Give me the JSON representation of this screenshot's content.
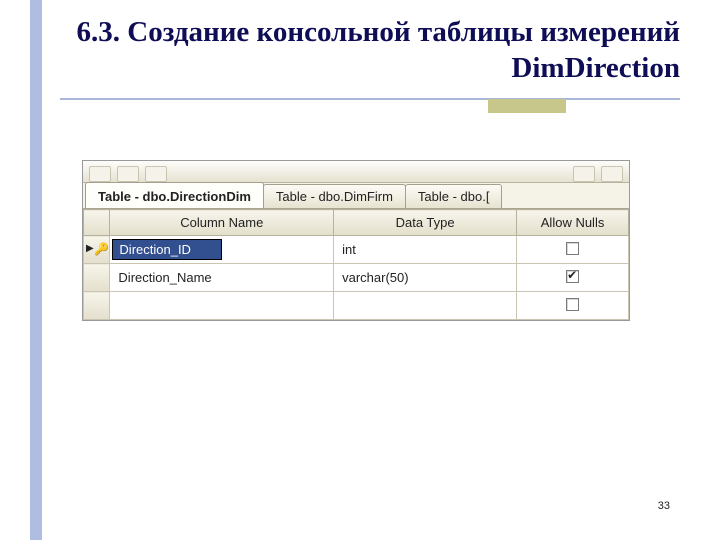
{
  "slide": {
    "title": "6.3. Создание консольной таблицы измерений DimDirection",
    "page_number": "33"
  },
  "designer": {
    "tabs": [
      {
        "label": "Table - dbo.DirectionDim",
        "active": true
      },
      {
        "label": "Table - dbo.DimFirm",
        "active": false
      },
      {
        "label": "Table - dbo.[",
        "active": false
      }
    ],
    "headers": {
      "column_name": "Column Name",
      "data_type": "Data Type",
      "allow_nulls": "Allow Nulls"
    },
    "rows": [
      {
        "name": "Direction_ID",
        "type": "int",
        "allow_nulls": false,
        "pk": true,
        "selected": true
      },
      {
        "name": "Direction_Name",
        "type": "varchar(50)",
        "allow_nulls": true,
        "pk": false,
        "selected": false
      },
      {
        "name": "",
        "type": "",
        "allow_nulls": false,
        "pk": false,
        "selected": false
      }
    ]
  }
}
